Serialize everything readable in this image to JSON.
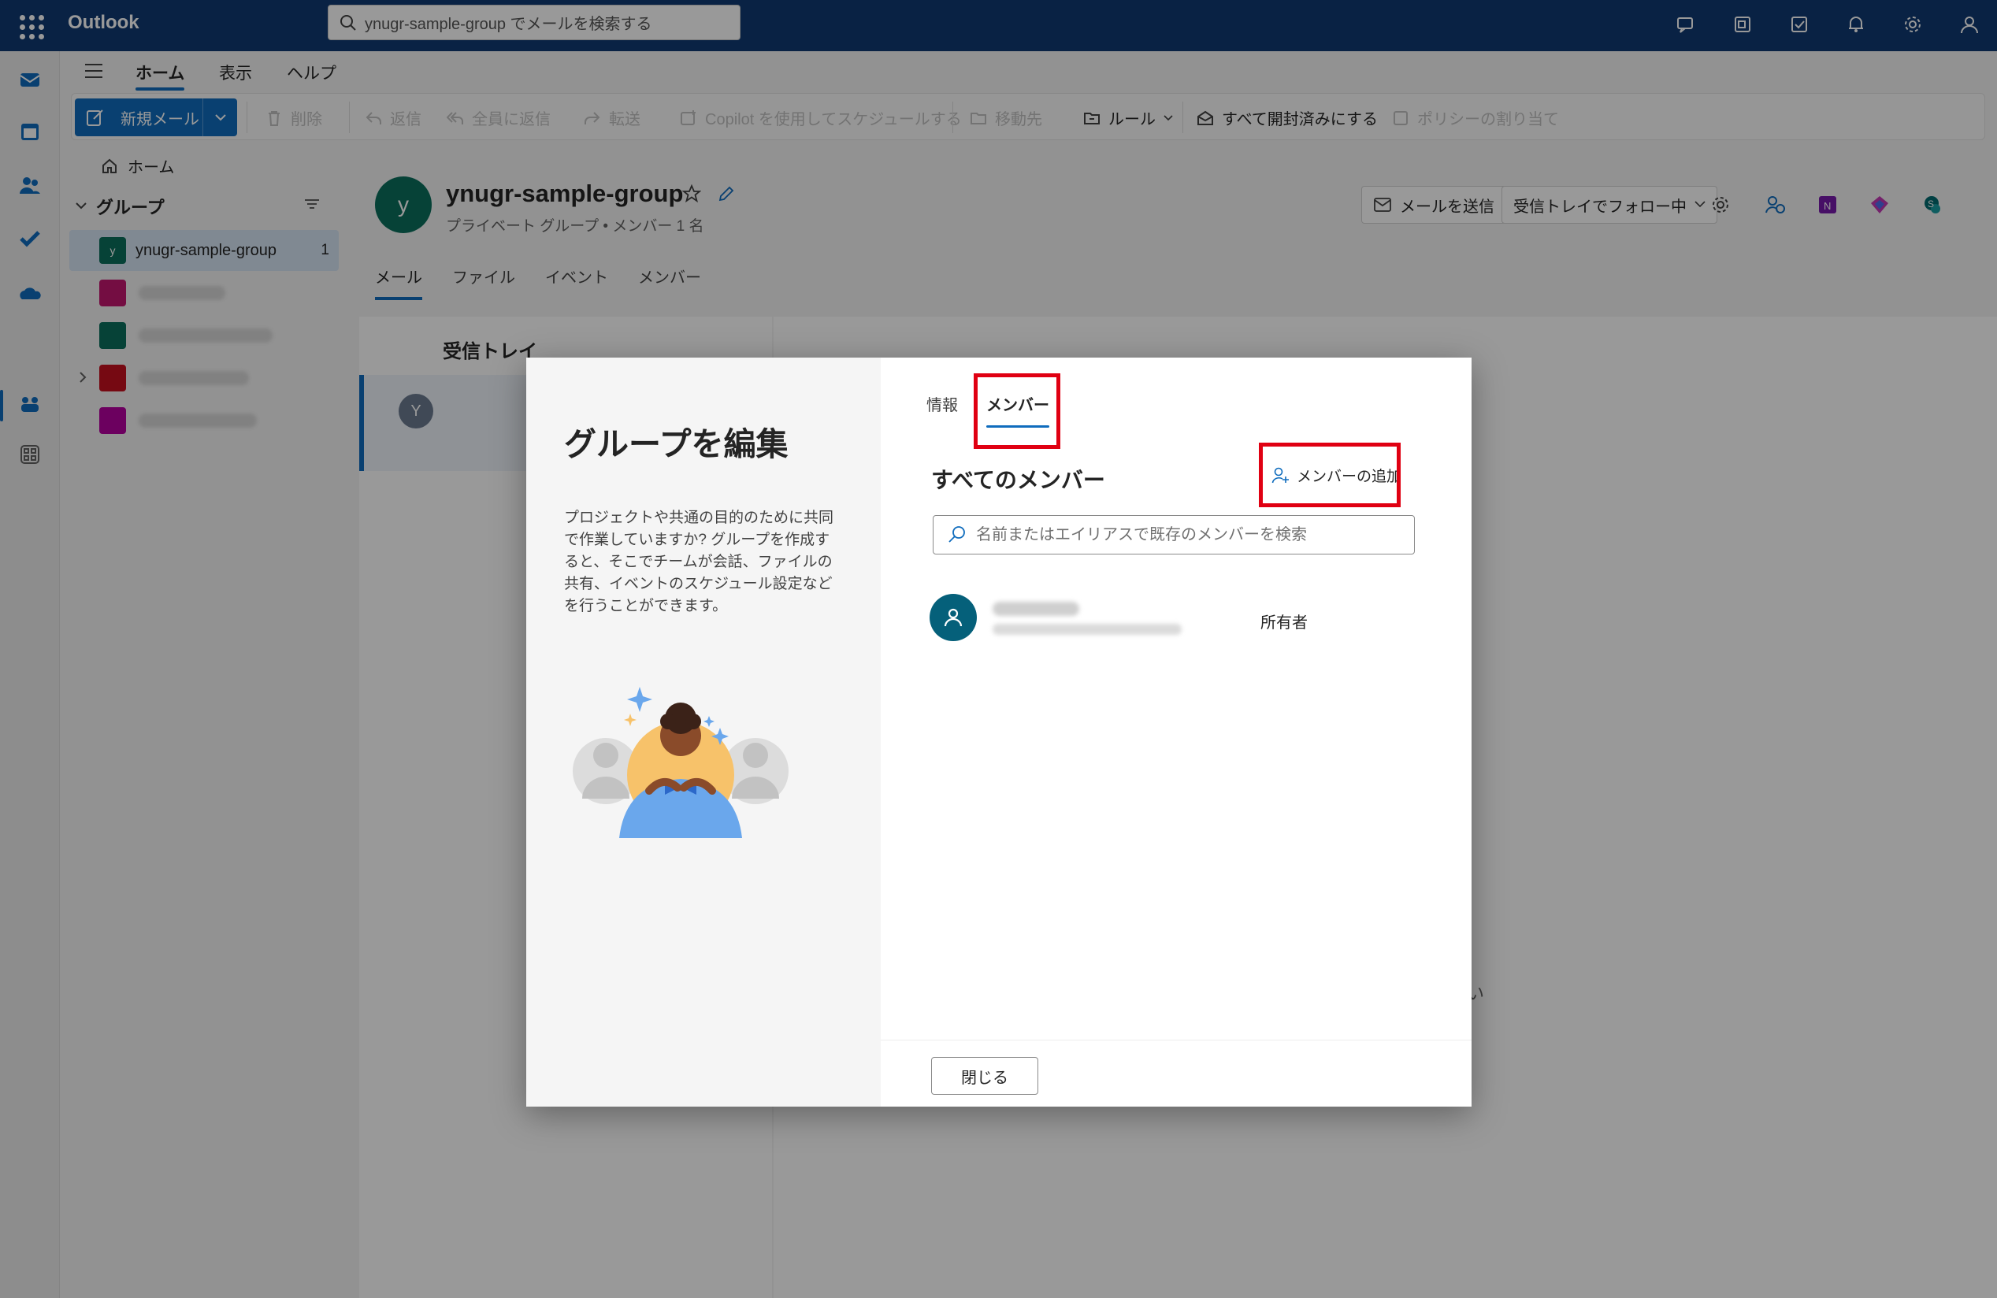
{
  "app": {
    "name": "Outlook"
  },
  "search": {
    "placeholder": "ynugr-sample-group でメールを検索する"
  },
  "ribbon_tabs": [
    "ホーム",
    "表示",
    "ヘルプ"
  ],
  "ribbon": {
    "new_mail": "新規メール",
    "delete": "削除",
    "reply": "返信",
    "reply_all": "全員に返信",
    "forward": "転送",
    "copilot": "Copilot を使用してスケジュールする",
    "move_to": "移動先",
    "rules": "ルール",
    "mark_all_read": "すべて開封済みにする",
    "policy": "ポリシーの割り当て"
  },
  "folder_pane": {
    "home": "ホーム",
    "groups_heading": "グループ",
    "groups": [
      {
        "name": "ynugr-sample-group",
        "count": "1",
        "initial": "y",
        "color": "#0b6e5c"
      }
    ]
  },
  "group": {
    "initial": "y",
    "name": "ynugr-sample-group",
    "subtitle": "プライベート グループ • メンバー 1 名",
    "tabs": [
      "メール",
      "ファイル",
      "イベント",
      "メンバー"
    ],
    "send_mail": "メールを送信",
    "follow": "受信トレイでフォロー中"
  },
  "message_list": {
    "title": "受信トレイ",
    "first_initial": "Y"
  },
  "reading_pane": {
    "peek": "い"
  },
  "dialog": {
    "title": "グループを編集",
    "description": "プロジェクトや共通の目的のために共同で作業していますか? グループを作成すると、そこでチームが会話、ファイルの共有、イベントのスケジュール設定などを行うことができます。",
    "tabs": {
      "info": "情報",
      "members": "メンバー"
    },
    "all_members": "すべてのメンバー",
    "add_member": "メンバーの追加",
    "member_search_placeholder": "名前またはエイリアスで既存のメンバーを検索",
    "members": [
      {
        "role": "所有者"
      }
    ],
    "close": "閉じる"
  },
  "colors": {
    "topbar": "#0f3a72",
    "accent": "#0f6cbd",
    "highlight": "#e00012",
    "member_avatar": "#05607a"
  }
}
